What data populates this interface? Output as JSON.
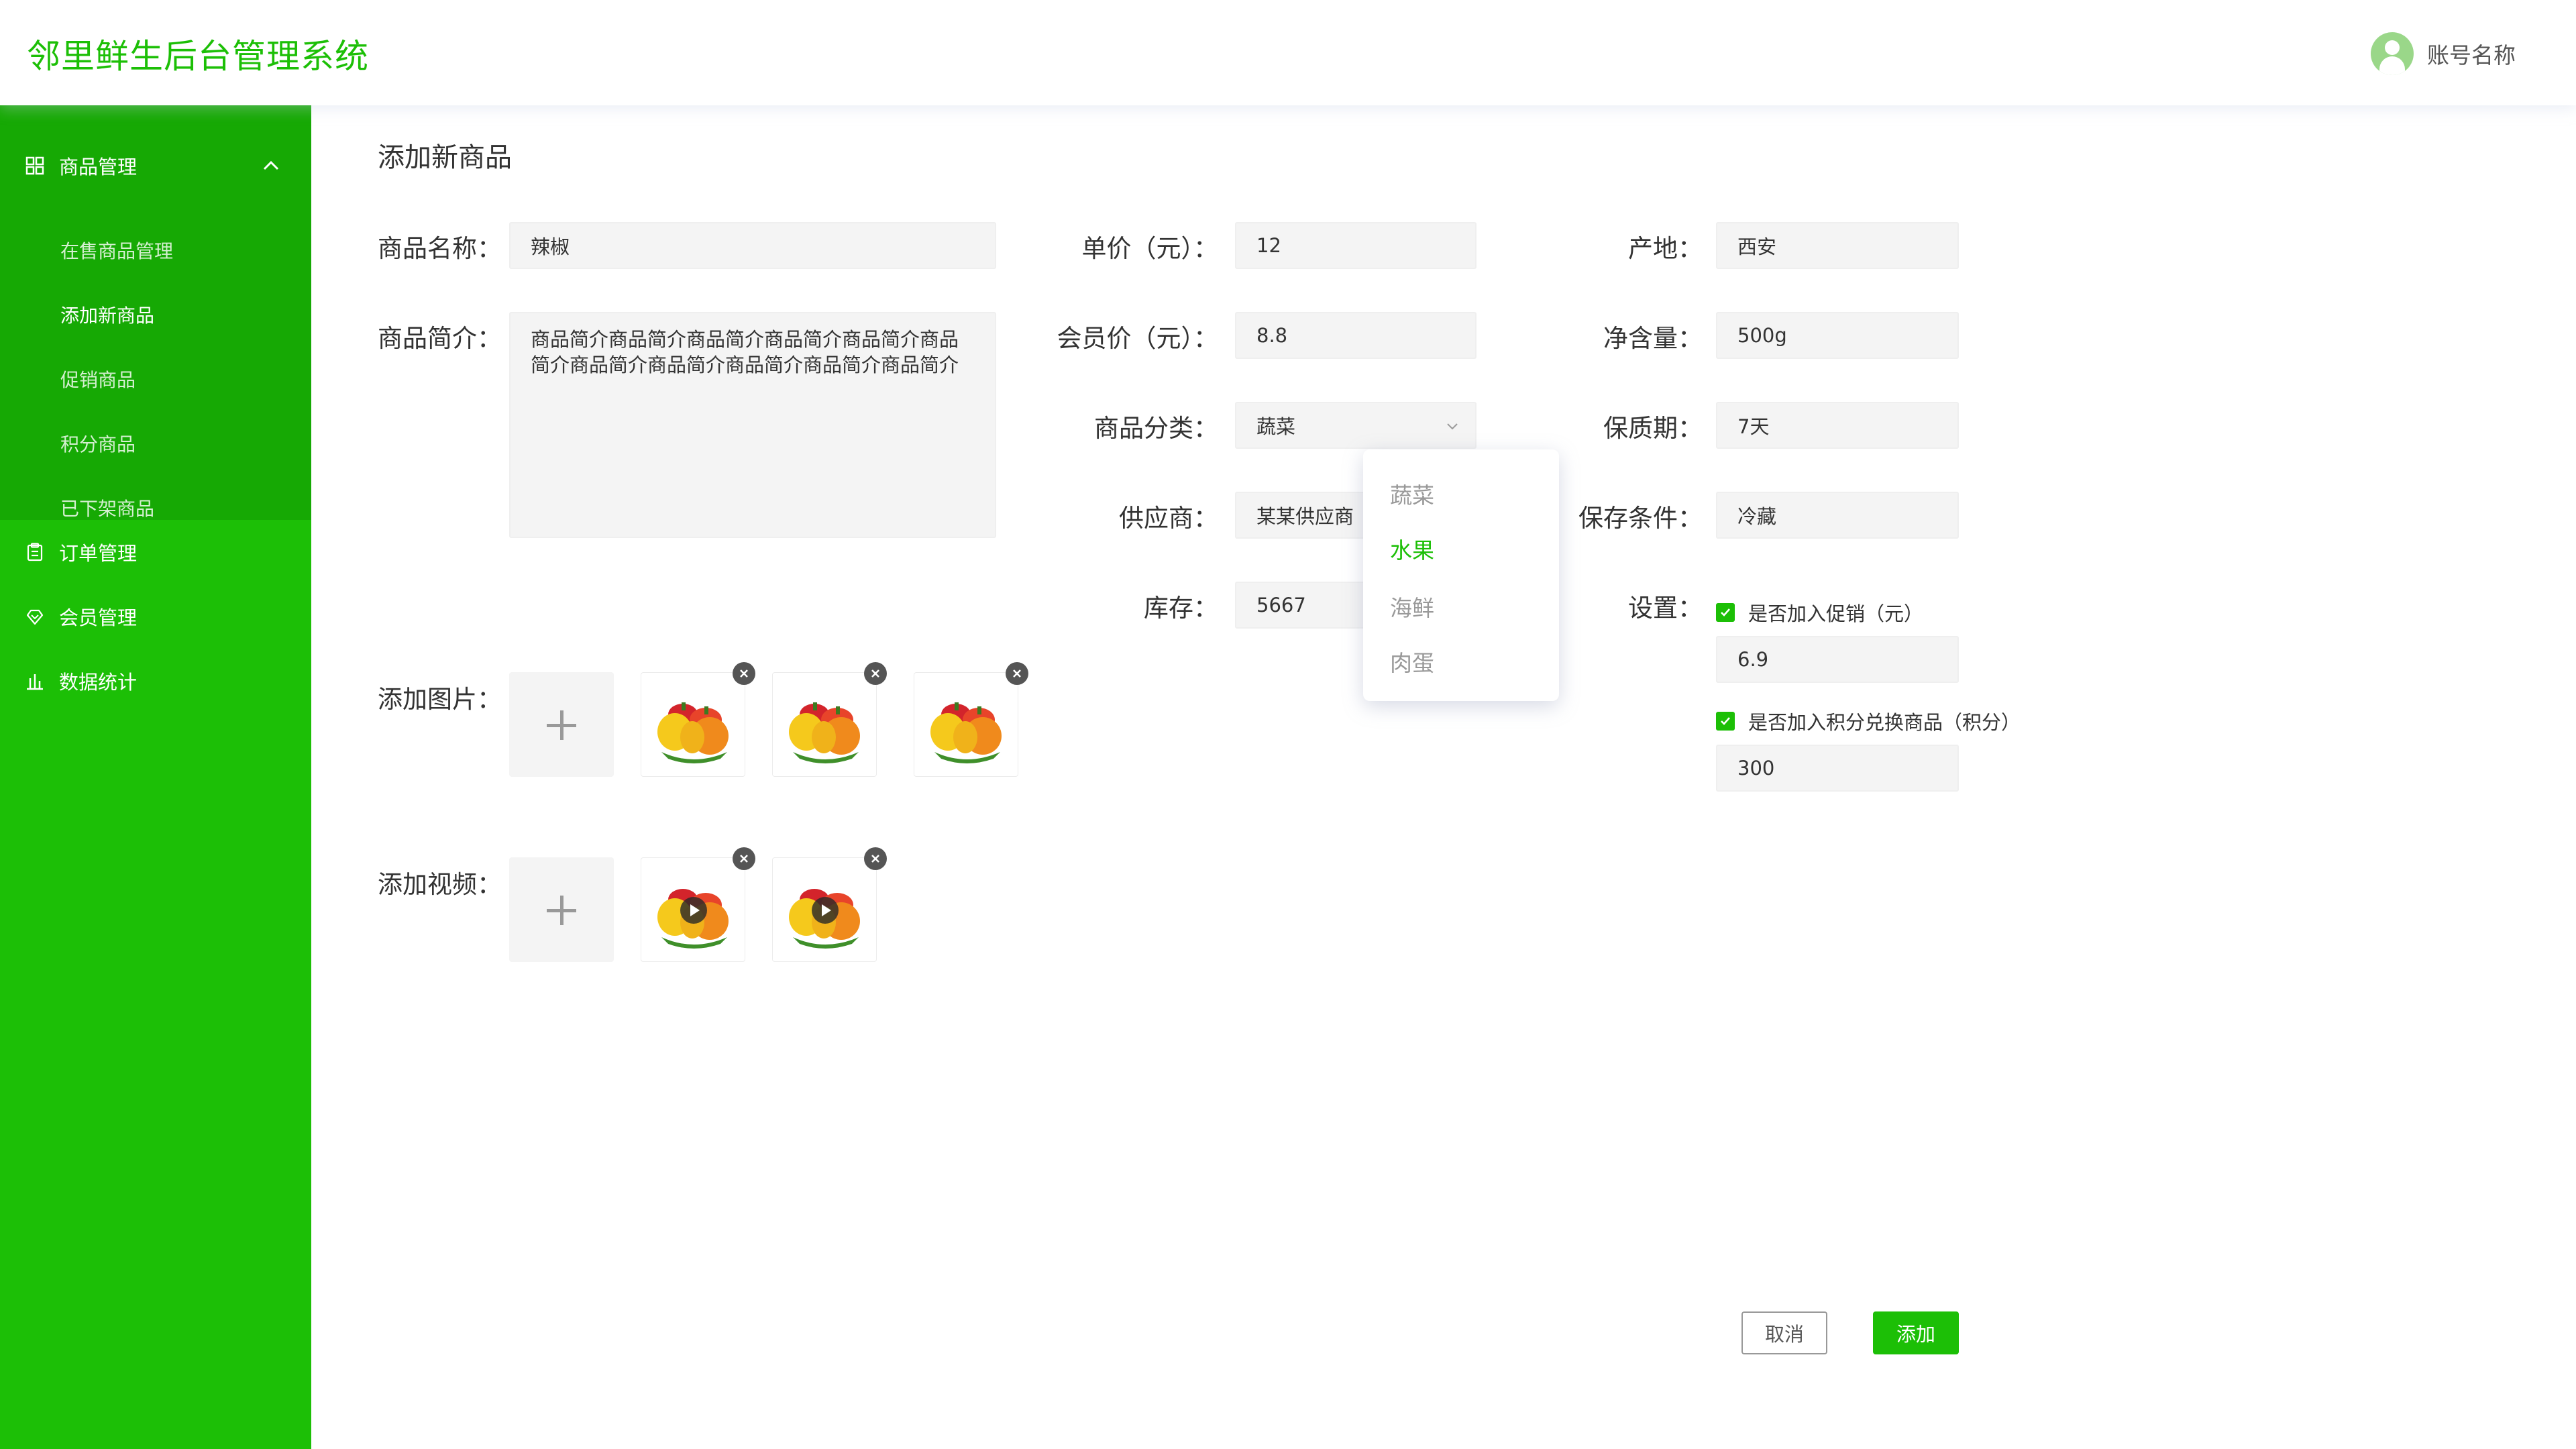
{
  "header": {
    "title": "邻里鲜生后台管理系统",
    "account_name": "账号名称"
  },
  "sidebar": {
    "group_product": "商品管理",
    "sub_items": [
      "在售商品管理",
      "添加新商品",
      "促销商品",
      "积分商品",
      "已下架商品"
    ],
    "active_sub": "添加新商品",
    "orders": "订单管理",
    "members": "会员管理",
    "stats": "数据统计"
  },
  "page": {
    "title": "添加新商品"
  },
  "form": {
    "name_label": "商品名称：",
    "name_value": "辣椒",
    "desc_label": "商品简介：",
    "desc_value": "商品简介商品简介商品简介商品简介商品简介商品简介商品简介商品简介商品简介商品简介商品简介",
    "price_label": "单价（元）：",
    "price_value": "12",
    "member_price_label": "会员价（元）：",
    "member_price_value": "8.8",
    "category_label": "商品分类：",
    "category_value": "蔬菜",
    "supplier_label": "供应商：",
    "supplier_value": "某某供应商",
    "stock_label": "库存：",
    "stock_value": "5667",
    "origin_label": "产地：",
    "origin_value": "西安",
    "net_label": "净含量：",
    "net_value": "500g",
    "shelf_label": "保质期：",
    "shelf_value": "7天",
    "storage_label": "保存条件：",
    "storage_value": "冷藏",
    "settings_label": "设置：",
    "promo_check": "是否加入促销（元）",
    "promo_value": "6.9",
    "points_check": "是否加入积分兑换商品（积分）",
    "points_value": "300",
    "images_label": "添加图片：",
    "video_label": "添加视频："
  },
  "dropdown": {
    "options": [
      "蔬菜",
      "水果",
      "海鲜",
      "肉蛋"
    ],
    "highlighted": "水果"
  },
  "buttons": {
    "cancel": "取消",
    "add": "添加"
  },
  "colors": {
    "brand": "#1cbf06",
    "sidebar_sub": "#16a904"
  }
}
